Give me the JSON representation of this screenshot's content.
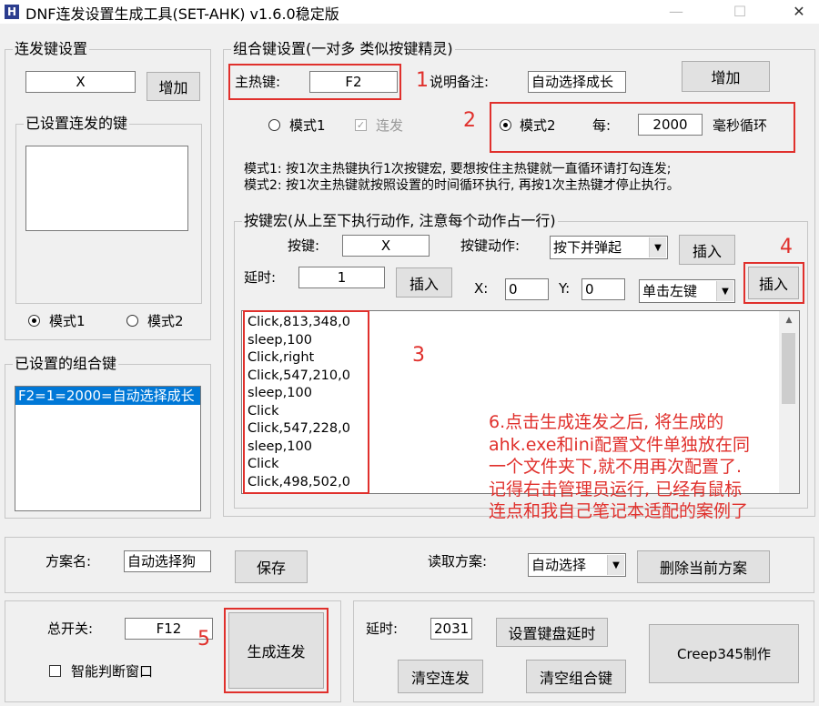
{
  "window": {
    "title": "DNF连发设置生成工具(SET-AHK) v1.6.0稳定版",
    "app_icon": "H",
    "controls": {
      "minimize": "—",
      "maximize": "☐",
      "close": "✕"
    }
  },
  "burst_group": {
    "title": "连发键设置",
    "key_value": "X",
    "add_label": "增加",
    "set_keys_title": "已设置连发的键",
    "mode1": "模式1",
    "mode2": "模式2"
  },
  "combo_list_group": {
    "title": "已设置的组合键",
    "items": [
      "F2=1=2000=自动选择成长"
    ]
  },
  "combo_group": {
    "title": "组合键设置(一对多 类似按键精灵)",
    "hotkey_label": "主热键:",
    "hotkey_value": "F2",
    "note_label": "说明备注:",
    "note_value": "自动选择成长",
    "add_label": "增加",
    "mode1": "模式1",
    "burst_check": "连发",
    "mode2": "模式2",
    "every_label": "每:",
    "interval_value": "2000",
    "ms_label": "毫秒循环",
    "desc1": "模式1: 按1次主热键执行1次按键宏, 要想按住主热键就一直循环请打勾连发;",
    "desc2": "模式2: 按1次主热键就按照设置的时间循环执行, 再按1次主热键才停止执行。"
  },
  "macro_group": {
    "title": "按键宏(从上至下执行动作, 注意每个动作占一行)",
    "key_label": "按键:",
    "key_value": "X",
    "action_label": "按键动作:",
    "action_value": "按下并弹起",
    "insert_label": "插入",
    "delay_label": "延时:",
    "delay_value": "1",
    "x_label": "X:",
    "x_value": "0",
    "y_label": "Y:",
    "y_value": "0",
    "mouse_value": "单击左键",
    "lines": [
      "Click,813,348,0",
      "sleep,100",
      "Click,right",
      "Click,547,210,0",
      "sleep,100",
      "Click",
      "Click,547,228,0",
      "sleep,100",
      "Click",
      "Click,498,502,0"
    ]
  },
  "annotations": {
    "n1": "1",
    "n2": "2",
    "n3": "3",
    "n4": "4",
    "n5": "5",
    "note6": [
      "6.点击生成连发之后, 将生成的",
      "ahk.exe和ini配置文件单独放在同",
      "一个文件夹下,就不用再次配置了.",
      "记得右击管理员运行, 已经有鼠标",
      "连点和我自己笔记本适配的案例了"
    ],
    "color": "#e0302c"
  },
  "scheme": {
    "name_label": "方案名:",
    "name_value": "自动选择狗",
    "save_label": "保存",
    "load_label": "读取方案:",
    "load_value": "自动选择",
    "delete_label": "删除当前方案"
  },
  "master": {
    "switch_label": "总开关:",
    "switch_value": "F12",
    "generate_label": "生成连发",
    "smart_label": "智能判断窗口"
  },
  "misc": {
    "delay_label": "延时:",
    "delay_value": "2031",
    "set_delay_label": "设置键盘延时",
    "clear_burst_label": "清空连发",
    "clear_combo_label": "清空组合键",
    "credit_label": "Creep345制作"
  }
}
